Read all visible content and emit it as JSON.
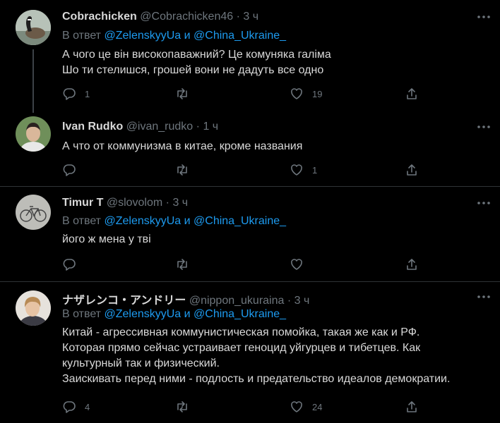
{
  "colors": {
    "background": "#000000",
    "text": "#d9d9d9",
    "muted": "#6e767d",
    "link": "#1d9bf0",
    "divider": "#2f3336"
  },
  "reply_prefix": "В ответ",
  "mention_conjunction": "и",
  "tweets": [
    {
      "name": "Cobrachicken",
      "handle": "@Cobrachicken46",
      "separator": "·",
      "time": "3 ч",
      "mentions": [
        "@ZelenskyyUa",
        "@China_Ukraine_"
      ],
      "lines": [
        "А чого це він високопаважний? Це комуняка галіма",
        "Шо ти стелишся, грошей вони не дадуть все одно"
      ],
      "reply_count": "1",
      "retweet_count": "",
      "like_count": "19"
    },
    {
      "name": "Ivan Rudko",
      "handle": "@ivan_rudko",
      "separator": "·",
      "time": "1 ч",
      "lines": [
        "А что от коммунизма в китае, кроме названия"
      ],
      "reply_count": "",
      "retweet_count": "",
      "like_count": "1"
    },
    {
      "name": "Timur T",
      "handle": "@slovolom",
      "separator": "·",
      "time": "3 ч",
      "mentions": [
        "@ZelenskyyUa",
        "@China_Ukraine_"
      ],
      "lines": [
        "його ж мена у тві"
      ],
      "reply_count": "",
      "retweet_count": "",
      "like_count": ""
    },
    {
      "name": "ナザレンコ・アンドリー",
      "handle": "@nippon_ukuraina",
      "separator": "·",
      "time": "3 ч",
      "mentions": [
        "@ZelenskyyUa",
        "@China_Ukraine_"
      ],
      "lines": [
        "Китай - агрессивная коммунистическая помойка, такая же как и РФ.",
        "Которая прямо сейчас устраивает геноцид уйгурцев и тибетцев. Как",
        "культурный так и физический.",
        "Заискивать перед ними - подлость и предательство идеалов демократии."
      ],
      "reply_count": "4",
      "retweet_count": "",
      "like_count": "24"
    }
  ]
}
